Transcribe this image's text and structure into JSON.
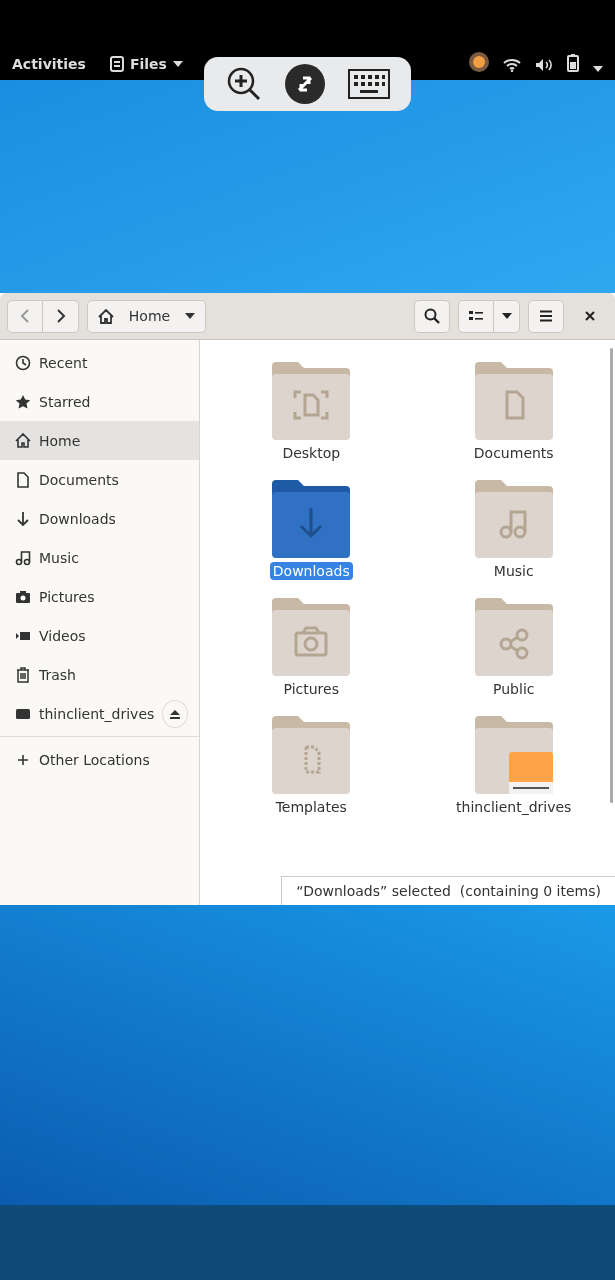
{
  "top_bar": {
    "activities": "Activities",
    "app_menu": "Files"
  },
  "window": {
    "location": "Home"
  },
  "sidebar": {
    "items": [
      {
        "kind": "recent",
        "label": "Recent",
        "selected": false
      },
      {
        "kind": "starred",
        "label": "Starred",
        "selected": false
      },
      {
        "kind": "home",
        "label": "Home",
        "selected": true
      },
      {
        "kind": "documents",
        "label": "Documents",
        "selected": false
      },
      {
        "kind": "downloads",
        "label": "Downloads",
        "selected": false
      },
      {
        "kind": "music",
        "label": "Music",
        "selected": false
      },
      {
        "kind": "pictures",
        "label": "Pictures",
        "selected": false
      },
      {
        "kind": "videos",
        "label": "Videos",
        "selected": false
      },
      {
        "kind": "trash",
        "label": "Trash",
        "selected": false
      },
      {
        "kind": "drive",
        "label": "thinclient_drives",
        "selected": false
      }
    ],
    "other": "Other Locations"
  },
  "folders": [
    {
      "kind": "desktop",
      "label": "Desktop",
      "selected": false
    },
    {
      "kind": "documents",
      "label": "Documents",
      "selected": false
    },
    {
      "kind": "downloads",
      "label": "Downloads",
      "selected": true
    },
    {
      "kind": "music",
      "label": "Music",
      "selected": false
    },
    {
      "kind": "pictures",
      "label": "Pictures",
      "selected": false
    },
    {
      "kind": "public",
      "label": "Public",
      "selected": false
    },
    {
      "kind": "templates",
      "label": "Templates",
      "selected": false
    },
    {
      "kind": "drive",
      "label": "thinclient_drives",
      "selected": false
    }
  ],
  "status": "“Downloads” selected  (containing 0 items)"
}
